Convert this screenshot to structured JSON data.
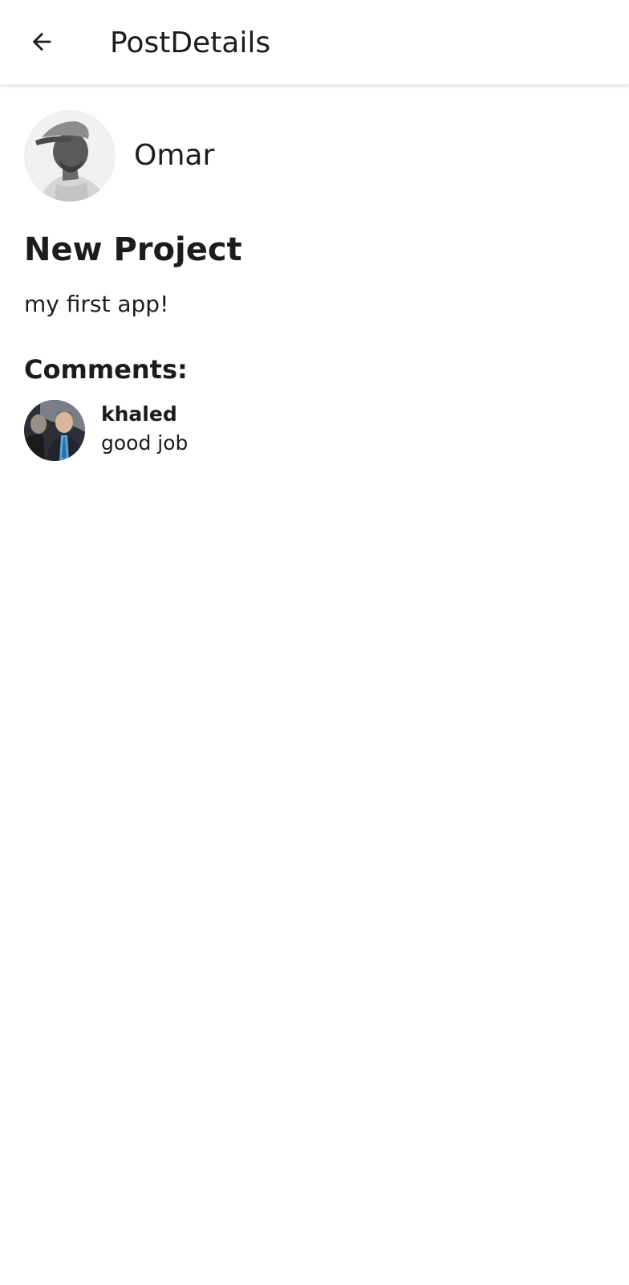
{
  "app_bar": {
    "title": "PostDetails",
    "back_icon": "arrow-left-icon"
  },
  "post": {
    "author": {
      "name": "Omar",
      "avatar_icon": "person-avatar"
    },
    "title": "New Project",
    "body": "my first app!"
  },
  "comments": {
    "heading": "Comments:",
    "items": [
      {
        "author": "khaled",
        "text": "good job",
        "avatar_icon": "person-avatar"
      }
    ]
  },
  "colors": {
    "background": "#ffffff",
    "text": "#1c1c1c",
    "appbar_shadow": "#ececec"
  }
}
